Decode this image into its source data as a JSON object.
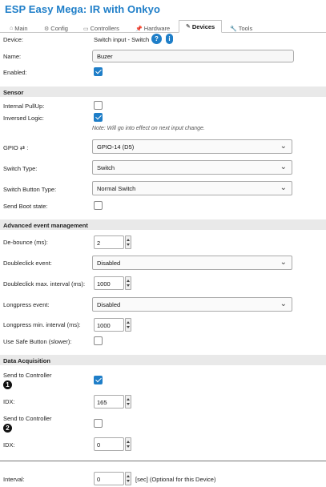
{
  "header": {
    "title": "ESP Easy Mega: IR with Onkyo"
  },
  "tabs": [
    {
      "label": "Main",
      "icon": "home-icon"
    },
    {
      "label": "Config",
      "icon": "gear-icon"
    },
    {
      "label": "Controllers",
      "icon": "controller-icon"
    },
    {
      "label": "Hardware",
      "icon": "pin-icon"
    },
    {
      "label": "Devices",
      "icon": "pencil-icon",
      "active": true
    },
    {
      "label": "Tools",
      "icon": "wrench-icon"
    }
  ],
  "device": {
    "label": "Device:",
    "value": "Switch input - Switch",
    "help_icon": "?",
    "info_icon": "i",
    "name_label": "Name:",
    "name_value": "Buzer",
    "enabled_label": "Enabled:",
    "enabled": true
  },
  "sensor": {
    "section_title": "Sensor",
    "pullup_label": "Internal PullUp:",
    "pullup": false,
    "inversed_label": "Inversed Logic:",
    "inversed": true,
    "note": "Note: Will go into effect on next input change.",
    "gpio_label": "GPIO ⇄ :",
    "gpio_value": "GPIO-14 (D5)",
    "switch_type_label": "Switch Type:",
    "switch_type_value": "Switch",
    "switch_button_type_label": "Switch Button Type:",
    "switch_button_type_value": "Normal Switch",
    "send_boot_label": "Send Boot state:",
    "send_boot": false
  },
  "advanced": {
    "section_title": "Advanced event management",
    "debounce_label": "De-bounce (ms):",
    "debounce_value": "2",
    "doubleclick_label": "Doubleclick event:",
    "doubleclick_value": "Disabled",
    "doubleclick_interval_label": "Doubleclick max. interval (ms):",
    "doubleclick_interval_value": "1000",
    "longpress_label": "Longpress event:",
    "longpress_value": "Disabled",
    "longpress_interval_label": "Longpress min. interval (ms):",
    "longpress_interval_value": "1000",
    "safe_button_label": "Use Safe Button (slower):",
    "safe_button": false
  },
  "acquisition": {
    "section_title": "Data Acquisition",
    "send1_label": "Send to Controller",
    "send1_badge": "1",
    "send1": true,
    "idx1_label": "IDX:",
    "idx1_value": "165",
    "send2_label": "Send to Controller",
    "send2_badge": "2",
    "send2": false,
    "idx2_label": "IDX:",
    "idx2_value": "0"
  },
  "interval": {
    "label": "Interval:",
    "value": "0",
    "unit": "[sec] (Optional for this Device)"
  }
}
